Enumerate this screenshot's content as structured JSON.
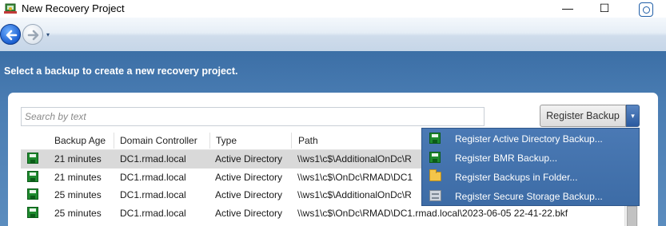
{
  "window": {
    "title": "New Recovery Project",
    "minimize_glyph": "—",
    "maximize_glyph": "☐"
  },
  "nav": {
    "back_icon": "back-arrow-icon",
    "forward_icon": "forward-arrow-icon",
    "history_caret": "▾"
  },
  "main": {
    "prompt": "Select a backup to create a new recovery project."
  },
  "search": {
    "placeholder": "Search by text"
  },
  "register": {
    "label": "Register Backup",
    "caret": "▾"
  },
  "table": {
    "columns": [
      "Backup Age",
      "Domain Controller",
      "Type",
      "Path"
    ],
    "rows": [
      {
        "age": "21 minutes",
        "dc": "DC1.rmad.local",
        "type": "Active Directory",
        "path": "\\\\ws1\\c$\\AdditionalOnDc\\R",
        "selected": true
      },
      {
        "age": "21 minutes",
        "dc": "DC1.rmad.local",
        "type": "Active Directory",
        "path": "\\\\ws1\\c$\\OnDc\\RMAD\\DC1",
        "selected": false
      },
      {
        "age": "25 minutes",
        "dc": "DC1.rmad.local",
        "type": "Active Directory",
        "path": "\\\\ws1\\c$\\AdditionalOnDc\\R",
        "selected": false
      },
      {
        "age": "25 minutes",
        "dc": "DC1.rmad.local",
        "type": "Active Directory",
        "path": "\\\\ws1\\c$\\OnDc\\RMAD\\DC1.rmad.local\\2023-06-05 22-41-22.bkf",
        "selected": false
      }
    ]
  },
  "menu": {
    "items": [
      {
        "label": "Register Active Directory Backup...",
        "icon": "disk-icon"
      },
      {
        "label": "Register BMR Backup...",
        "icon": "disk-icon"
      },
      {
        "label": "Register Backups in Folder...",
        "icon": "folder-icon"
      },
      {
        "label": "Register Secure Storage Backup...",
        "icon": "storage-icon"
      }
    ]
  },
  "colors": {
    "header_blue": "#3c6fa6",
    "menu_blue": "#4a79b4",
    "selected_row": "#d9d9d9"
  }
}
